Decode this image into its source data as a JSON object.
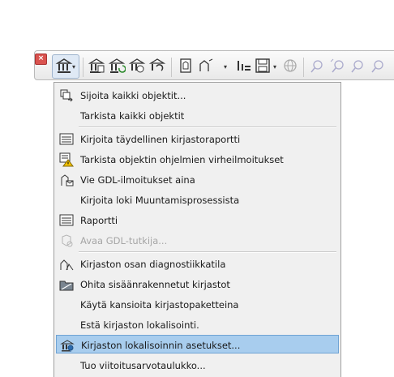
{
  "toolbar": {
    "close_label": "×",
    "dropdown_arrow": "▾"
  },
  "menu": {
    "items": [
      {
        "label": "Sijoita kaikki objektit...",
        "icon": "place-objects-icon"
      },
      {
        "label": "Tarkista kaikki objektit",
        "icon": ""
      },
      {
        "label": "Kirjoita täydellinen kirjastoraportti",
        "icon": "report-icon"
      },
      {
        "label": "Tarkista objektin ohjelmien virheilmoitukset",
        "icon": "warning-icon"
      },
      {
        "label": "Vie GDL-ilmoitukset aina",
        "icon": "export-messages-icon"
      },
      {
        "label": "Kirjoita loki Muuntamisprosessista",
        "icon": ""
      },
      {
        "label": "Raportti",
        "icon": "report-icon"
      },
      {
        "label": "Avaa GDL-tutkija...",
        "icon": "gdl-debugger-icon"
      },
      {
        "label": "Kirjaston osan diagnostiikkatila",
        "icon": "diagnostics-icon"
      },
      {
        "label": "Ohita sisäänrakennetut kirjastot",
        "icon": "skip-builtin-icon"
      },
      {
        "label": "Käytä kansioita kirjastopaketteina",
        "icon": ""
      },
      {
        "label": "Estä kirjaston lokalisointi.",
        "icon": ""
      },
      {
        "label": "Kirjaston lokalisoinnin asetukset...",
        "icon": "localization-settings-icon"
      },
      {
        "label": "Tuo viitoitusarvotaulukko...",
        "icon": ""
      }
    ]
  }
}
